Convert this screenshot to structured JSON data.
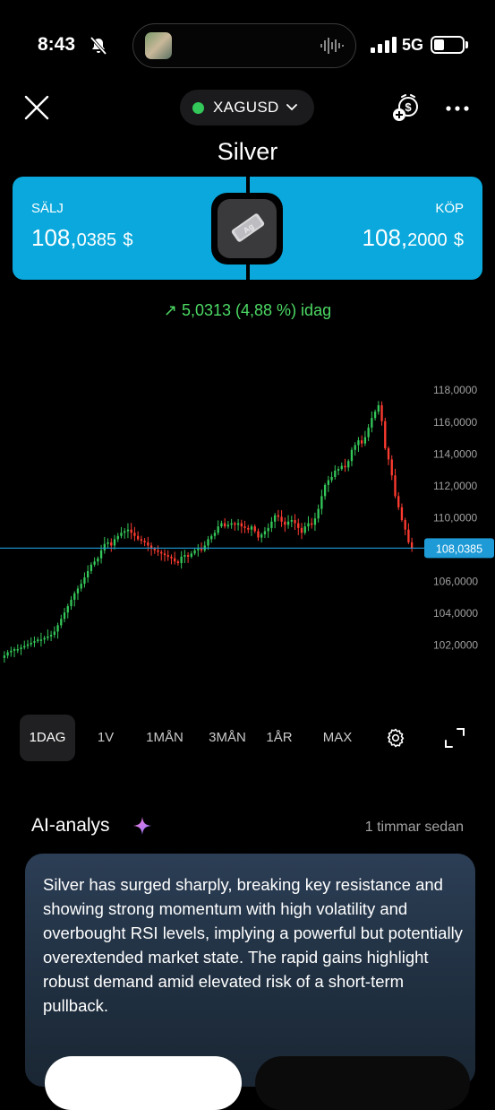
{
  "status_bar": {
    "time": "8:43",
    "network": "5G"
  },
  "header": {
    "symbol": "XAGUSD",
    "title": "Silver"
  },
  "price_card": {
    "sell_label": "SÄLJ",
    "sell_main": "108,",
    "sell_small": "0385",
    "sell_currency": "$",
    "buy_label": "KÖP",
    "buy_main": "108,",
    "buy_small": "2000",
    "buy_currency": "$",
    "metal_symbol": "Ag"
  },
  "change": {
    "text": "↗ 5,0313 (4,88 %) idag",
    "color": "#4cd964"
  },
  "chart_data": {
    "type": "candlestick",
    "y_ticks": [
      "118,0000",
      "116,0000",
      "114,0000",
      "112,0000",
      "110,0000",
      "108,0000",
      "106,0000",
      "104,0000",
      "102,0000"
    ],
    "current_price_label": "108,0385",
    "current_price": 108.0385,
    "ylim": [
      100.8,
      118.8
    ],
    "up_color": "#34c759",
    "down_color": "#ff3b30",
    "close_series": [
      101.3,
      101.5,
      101.6,
      101.7,
      101.7,
      101.8,
      101.9,
      102.0,
      102.1,
      102.2,
      102.3,
      102.3,
      102.4,
      102.5,
      102.6,
      102.8,
      103.2,
      103.6,
      104.0,
      104.4,
      104.8,
      105.2,
      105.5,
      105.8,
      106.2,
      106.6,
      107.0,
      107.2,
      107.4,
      107.9,
      108.3,
      108.4,
      108.2,
      108.6,
      108.8,
      109.0,
      109.1,
      109.2,
      109.0,
      108.8,
      108.6,
      108.5,
      108.4,
      108.2,
      108.0,
      107.9,
      107.8,
      107.7,
      107.6,
      107.5,
      107.4,
      107.2,
      107.1,
      107.5,
      107.6,
      107.5,
      107.7,
      107.9,
      108.0,
      107.9,
      108.2,
      108.6,
      108.8,
      109.0,
      109.4,
      109.6,
      109.4,
      109.5,
      109.6,
      109.5,
      109.6,
      109.4,
      109.3,
      109.2,
      109.4,
      109.1,
      108.7,
      108.9,
      109.1,
      109.3,
      109.7,
      110.1,
      110.0,
      109.7,
      109.5,
      109.7,
      109.8,
      109.6,
      109.3,
      109.0,
      109.4,
      109.6,
      109.5,
      109.9,
      110.5,
      111.3,
      112.0,
      112.3,
      112.5,
      112.9,
      113.0,
      113.2,
      113.1,
      113.5,
      114.2,
      114.5,
      114.8,
      114.6,
      115.0,
      115.6,
      116.2,
      116.6,
      117.0,
      116.0,
      114.3,
      113.6,
      112.6,
      111.3,
      110.6,
      109.8,
      109.2,
      108.4,
      108.0
    ]
  },
  "timeframes": [
    "1DAG",
    "1V",
    "1MÅN",
    "3MÅN",
    "1ÅR",
    "MAX"
  ],
  "active_timeframe": "1DAG",
  "ai": {
    "title": "AI-analys",
    "time": "1 timmar sedan",
    "text": "Silver has surged sharply, breaking key resistance and showing strong momentum with high volatility and overbought RSI levels, implying a powerful but potentially overextended market state. The rapid gains highlight robust demand amid elevated risk of a short-term pullback."
  },
  "icons": {
    "bell": "bell-slash-icon",
    "close": "close-icon",
    "alert": "price-alert-icon",
    "more": "more-icon",
    "gear": "gear-icon",
    "expand": "expand-icon",
    "sparkle": "sparkle-icon"
  },
  "colors": {
    "accent": "#0aa8dc",
    "price_line": "#1e9bd7",
    "positive": "#4cd964"
  }
}
